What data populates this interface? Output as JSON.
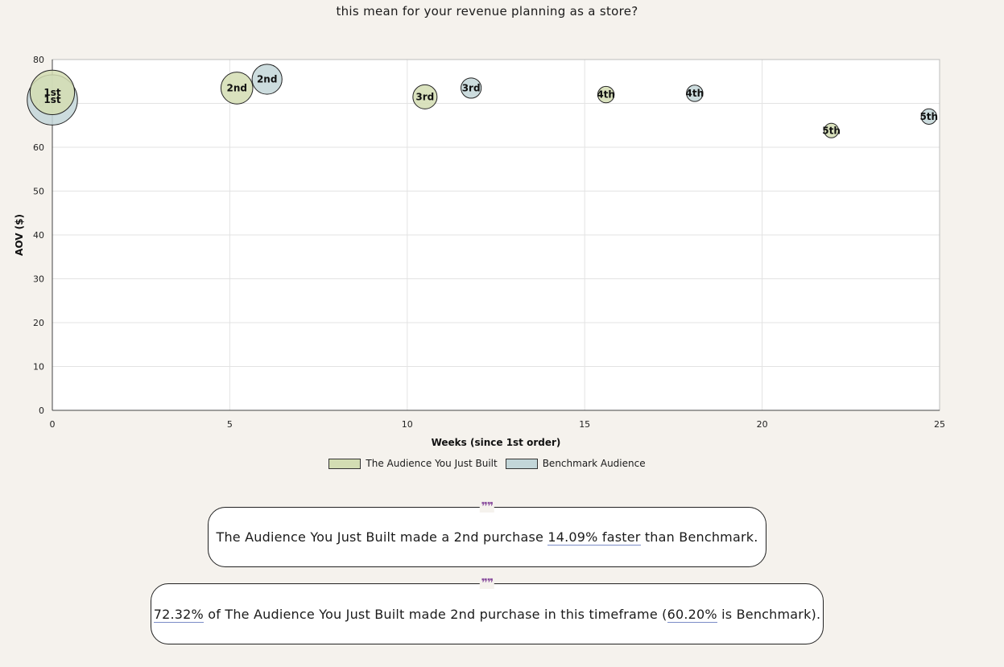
{
  "header": {
    "question_tail": "this mean for your revenue planning as a store?"
  },
  "chart_data": {
    "type": "scatter",
    "title": "",
    "xlabel": "Weeks (since 1st order)",
    "ylabel": "AOV ($)",
    "xlim": [
      0,
      25
    ],
    "ylim": [
      0,
      80
    ],
    "x_ticks": [
      "0",
      "5",
      "10",
      "15",
      "20",
      "25"
    ],
    "y_ticks": [
      "0",
      "10",
      "20",
      "30",
      "40",
      "50",
      "60",
      "70",
      "80"
    ],
    "grid": true,
    "legend_position": "bottom",
    "series": [
      {
        "name": "The Audience You Just Built",
        "color": "#d3ddb3",
        "points": [
          {
            "x": 0,
            "y": 72.5,
            "label": "1st",
            "size": 4.6
          },
          {
            "x": 5.2,
            "y": 73.5,
            "label": "2nd",
            "size": 3.3
          },
          {
            "x": 10.5,
            "y": 71.5,
            "label": "3rd",
            "size": 2.5
          },
          {
            "x": 15.6,
            "y": 72.0,
            "label": "4th",
            "size": 1.7
          },
          {
            "x": 21.95,
            "y": 63.8,
            "label": "5th",
            "size": 1.5
          }
        ]
      },
      {
        "name": "Benchmark Audience",
        "color": "#c3d6d8",
        "points": [
          {
            "x": 0,
            "y": 70.8,
            "label": "1st",
            "size": 5.2
          },
          {
            "x": 6.05,
            "y": 75.5,
            "label": "2nd",
            "size": 3.1
          },
          {
            "x": 11.8,
            "y": 73.5,
            "label": "3rd",
            "size": 2.1
          },
          {
            "x": 18.1,
            "y": 72.3,
            "label": "4th",
            "size": 1.7
          },
          {
            "x": 24.7,
            "y": 67.0,
            "label": "5th",
            "size": 1.6
          }
        ]
      }
    ]
  },
  "insights": [
    {
      "before": "The Audience You Just Built made a 2nd purchase ",
      "highlight": "14.09% faster",
      "after": " than Benchmark."
    },
    {
      "highlight_1": "72.32%",
      "middle": " of The Audience You Just Built made 2nd purchase in this timeframe (",
      "highlight_2": "60.20%",
      "after": " is Benchmark)."
    }
  ],
  "quote_icon": "❞❞"
}
